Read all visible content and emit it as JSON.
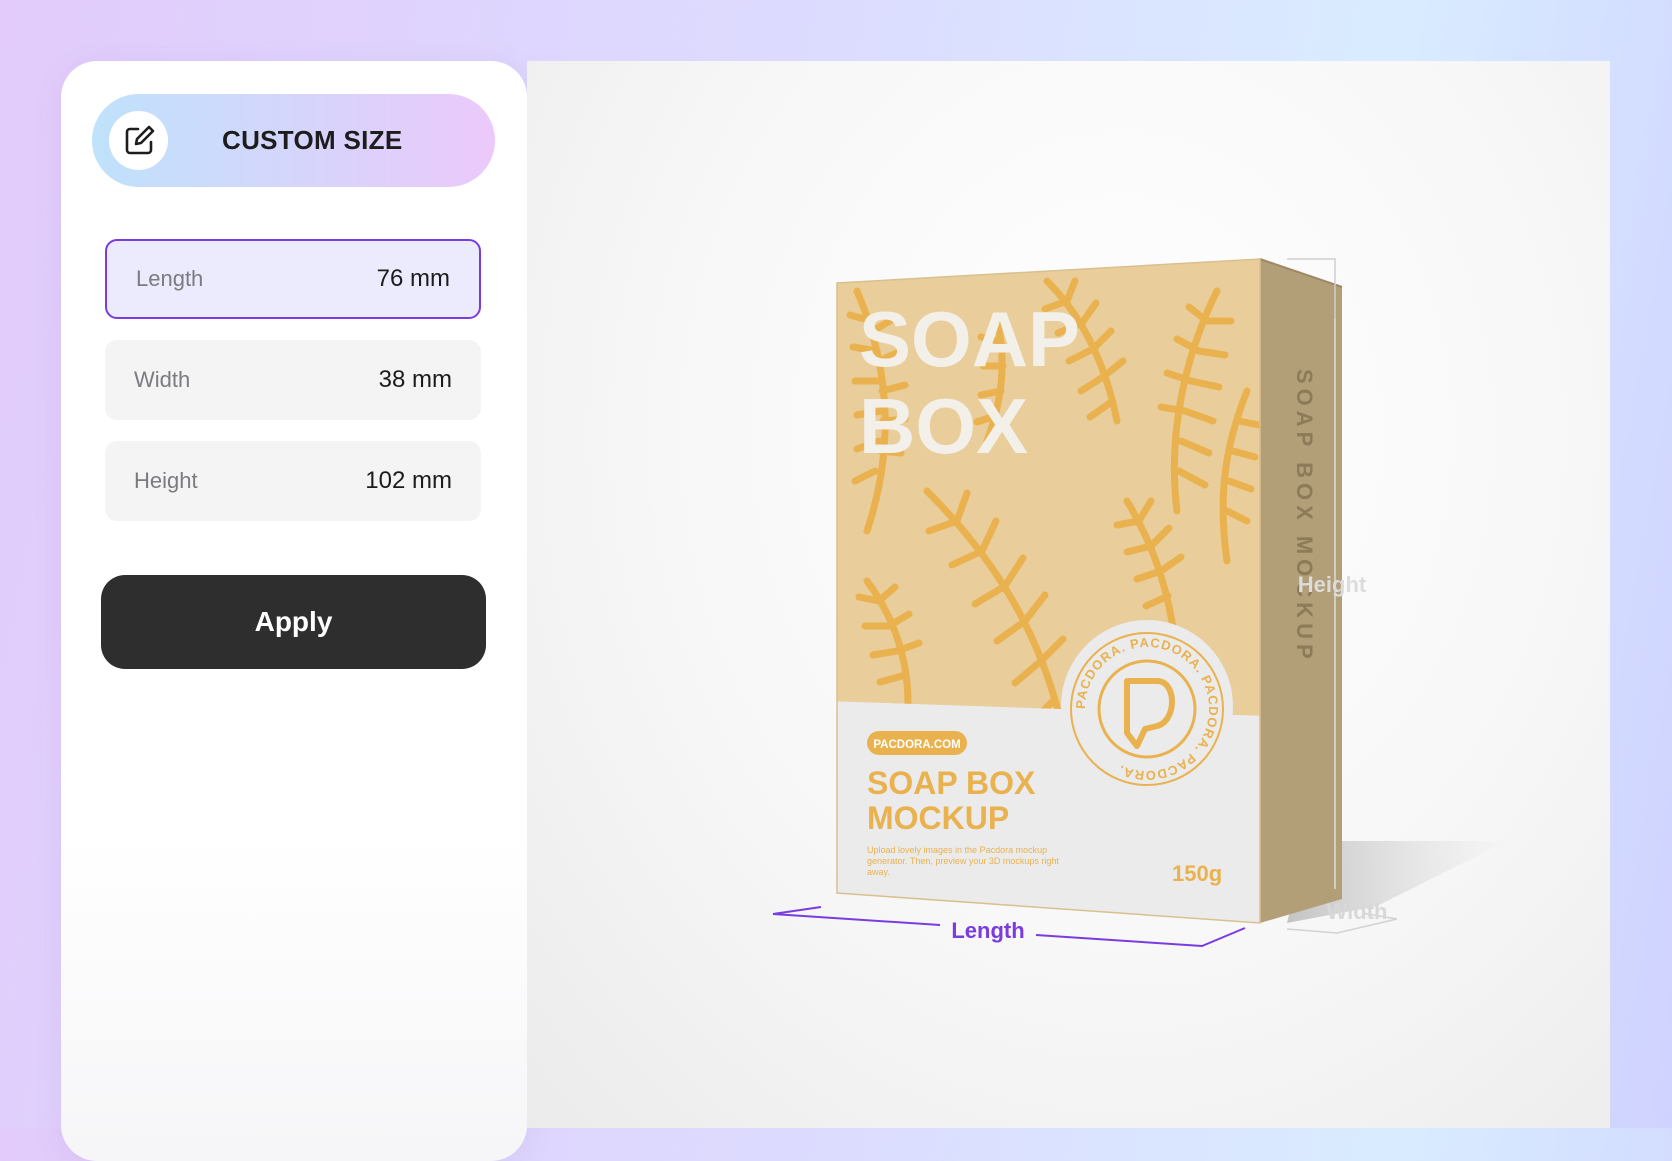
{
  "panel": {
    "title": "CUSTOM SIZE",
    "title_icon": "edit-icon",
    "fields": [
      {
        "label": "Length",
        "value": "76 mm",
        "active": true
      },
      {
        "label": "Width",
        "value": "38 mm",
        "active": false
      },
      {
        "label": "Height",
        "value": "102 mm",
        "active": false
      }
    ],
    "apply_label": "Apply"
  },
  "preview": {
    "front_title_line1": "SOAP",
    "front_title_line2": "BOX",
    "brand_tag": "PACDORA.COM",
    "product_line1": "SOAP BOX",
    "product_line2": "MOCKUP",
    "description_line1": "Upload lovely images in the Pacdora mockup",
    "description_line2": "generator. Then, preview your 3D mockups right",
    "description_line3": "away.",
    "weight": "150g",
    "seal_text": "PACDORA.  PACDORA.  PACDORA.  PACDORA.",
    "side_text": "SOAP BOX MOCKUP",
    "dim_length": "Length",
    "dim_width": "Width",
    "dim_height": "Height"
  },
  "colors": {
    "accent_purple": "#7a3ce0",
    "apply_bg": "#2e2e2e",
    "box_kraft": "#e9cd9a",
    "box_leaf": "#eab24f",
    "box_side": "#b39f77"
  }
}
